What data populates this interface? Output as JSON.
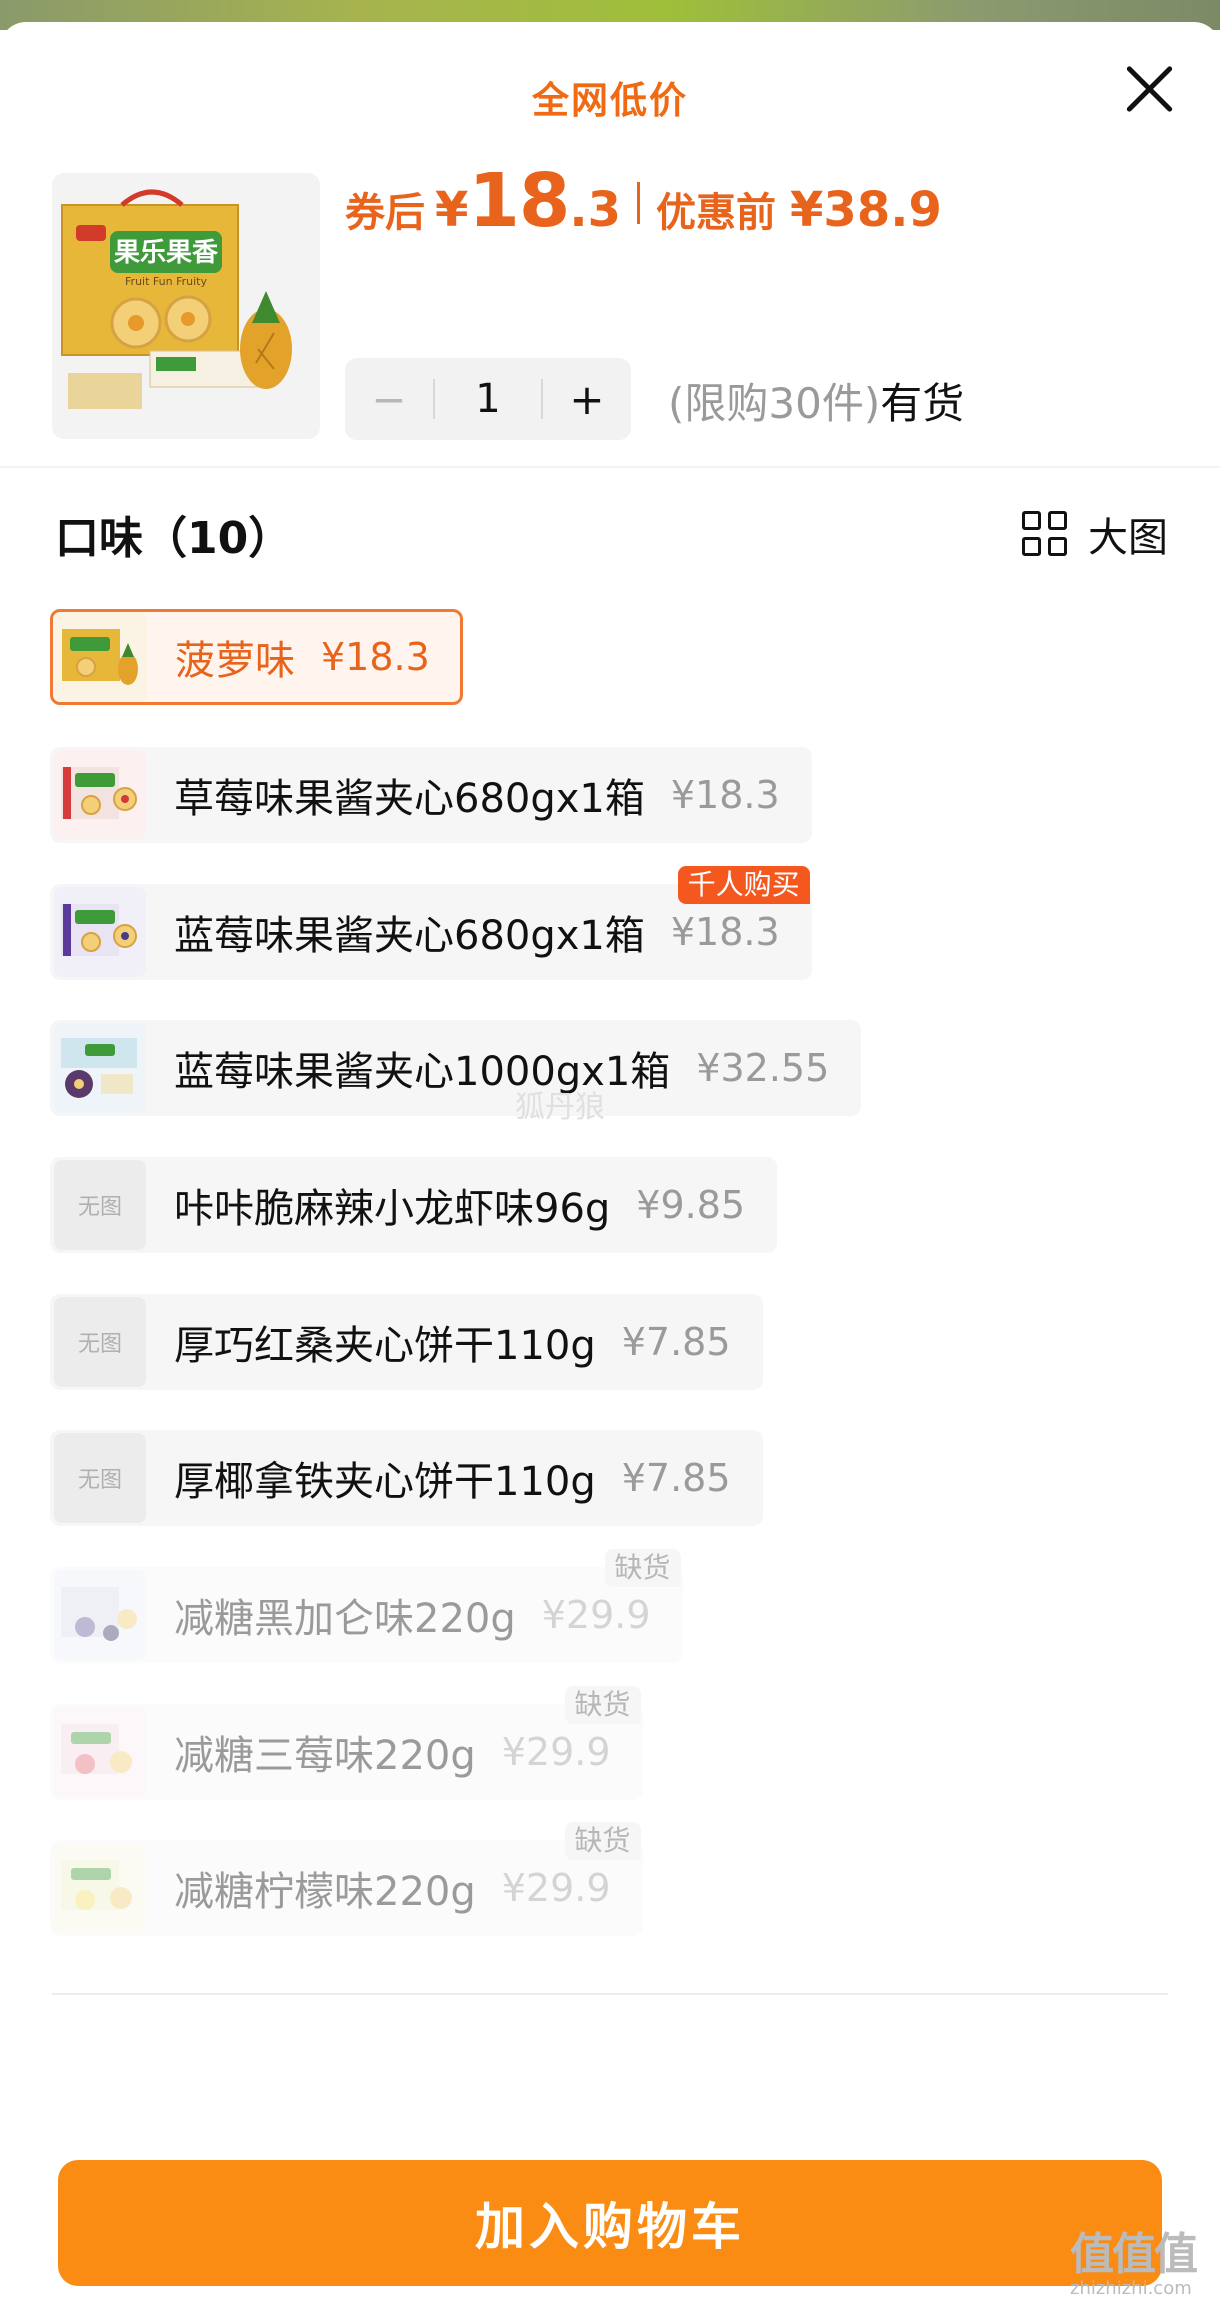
{
  "header": {
    "title": "全网低价",
    "close_icon": "close-icon"
  },
  "product": {
    "price_label": "券后",
    "currency": "¥",
    "price_int": "18",
    "price_frac": ".3",
    "orig_label": "优惠前",
    "orig_price": "¥38.9",
    "quantity": "1",
    "stock_limit": "(限购30件)",
    "stock_status": "有货"
  },
  "section": {
    "title": "口味（10）",
    "view_toggle": "大图",
    "view_icon": "grid-icon"
  },
  "options": [
    {
      "name": "菠萝味",
      "price": "¥18.3",
      "selected": true
    },
    {
      "name": "草莓味果酱夹心680gx1箱",
      "price": "¥18.3"
    },
    {
      "name": "蓝莓味果酱夹心680gx1箱",
      "price": "¥18.3",
      "badge": "千人购买"
    },
    {
      "name": "蓝莓味果酱夹心1000gx1箱",
      "price": "¥32.55"
    },
    {
      "name": "咔咔脆麻辣小龙虾味96g",
      "price": "¥9.85",
      "thumb_text": "无图"
    },
    {
      "name": "厚巧红桑夹心饼干110g",
      "price": "¥7.85",
      "thumb_text": "无图"
    },
    {
      "name": "厚椰拿铁夹心饼干110g",
      "price": "¥7.85",
      "thumb_text": "无图"
    },
    {
      "name": "减糖黑加仑味220g",
      "price": "¥29.9",
      "badge": "缺货",
      "out_of_stock": true
    },
    {
      "name": "减糖三莓味220g",
      "price": "¥29.9",
      "badge": "缺货",
      "out_of_stock": true
    },
    {
      "name": "减糖柠檬味220g",
      "price": "¥29.9",
      "badge": "缺货",
      "out_of_stock": true
    }
  ],
  "footer": {
    "add_to_cart": "加入购物车"
  },
  "watermarks": {
    "center": "狐丹狼",
    "corner_main": "值值值",
    "corner_sub": "zhizhizhi.com"
  },
  "colors": {
    "accent": "#e8641c",
    "button": "#fa8c14",
    "badge_hot": "#f4581f"
  }
}
